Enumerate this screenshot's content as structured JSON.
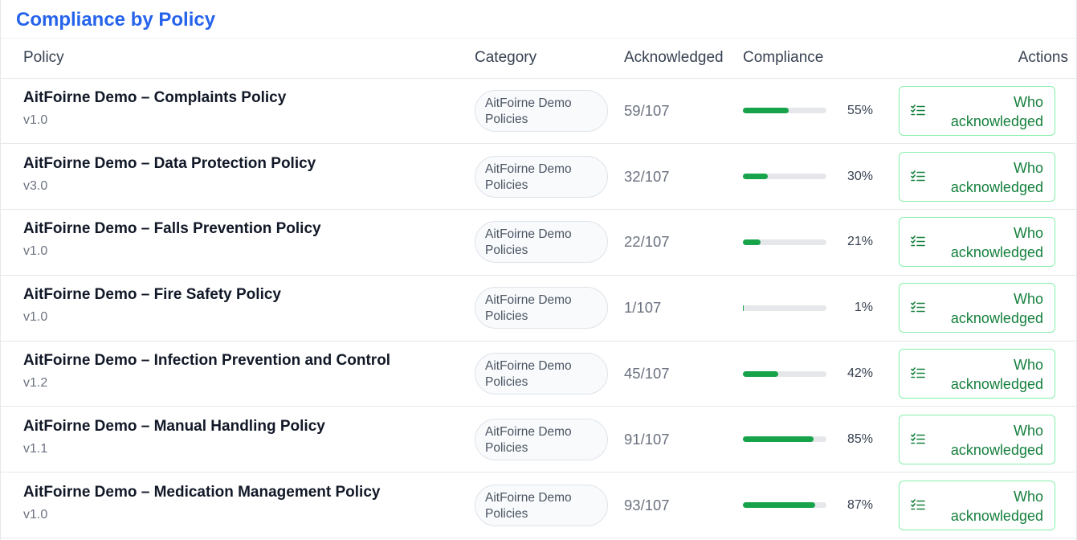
{
  "title": "Compliance by Policy",
  "columns": {
    "policy": "Policy",
    "category": "Category",
    "acknowledged": "Acknowledged",
    "compliance": "Compliance",
    "actions": "Actions"
  },
  "action_label": "Who acknowledged",
  "accent_color": "#2563eb",
  "progress_color": "#16a34a",
  "rows": [
    {
      "name": "AitFoirne Demo – Complaints Policy",
      "version": "v1.0",
      "category": "AitFoirne Demo Policies",
      "acknowledged": "59/107",
      "compliance_pct": 55,
      "compliance_label": "55%"
    },
    {
      "name": "AitFoirne Demo – Data Protection Policy",
      "version": "v3.0",
      "category": "AitFoirne Demo Policies",
      "acknowledged": "32/107",
      "compliance_pct": 30,
      "compliance_label": "30%"
    },
    {
      "name": "AitFoirne Demo – Falls Prevention Policy",
      "version": "v1.0",
      "category": "AitFoirne Demo Policies",
      "acknowledged": "22/107",
      "compliance_pct": 21,
      "compliance_label": "21%"
    },
    {
      "name": "AitFoirne Demo – Fire Safety Policy",
      "version": "v1.0",
      "category": "AitFoirne Demo Policies",
      "acknowledged": "1/107",
      "compliance_pct": 1,
      "compliance_label": "1%"
    },
    {
      "name": "AitFoirne Demo – Infection Prevention and Control",
      "version": "v1.2",
      "category": "AitFoirne Demo Policies",
      "acknowledged": "45/107",
      "compliance_pct": 42,
      "compliance_label": "42%"
    },
    {
      "name": "AitFoirne Demo – Manual Handling Policy",
      "version": "v1.1",
      "category": "AitFoirne Demo Policies",
      "acknowledged": "91/107",
      "compliance_pct": 85,
      "compliance_label": "85%"
    },
    {
      "name": "AitFoirne Demo – Medication Management Policy",
      "version": "v1.0",
      "category": "AitFoirne Demo Policies",
      "acknowledged": "93/107",
      "compliance_pct": 87,
      "compliance_label": "87%"
    }
  ]
}
